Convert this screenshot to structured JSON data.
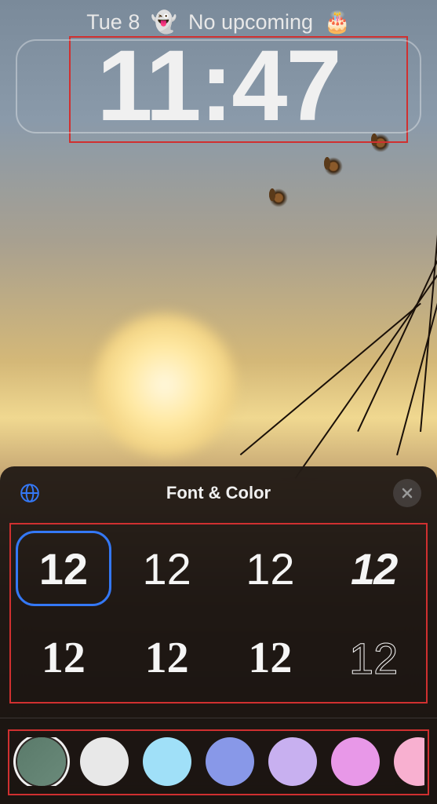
{
  "statusbar": {
    "date": "Tue 8",
    "ghost_icon": "👻",
    "upcoming_text": "No upcoming",
    "cake_icon": "🎂"
  },
  "clock": {
    "time": "11:47"
  },
  "sheet": {
    "title": "Font & Color",
    "globe_icon": "globe",
    "close_icon": "close"
  },
  "fonts": {
    "sample": "12",
    "options": [
      {
        "id": "sans-bold",
        "selected": true
      },
      {
        "id": "sans-light",
        "selected": false
      },
      {
        "id": "sans-regular",
        "selected": false
      },
      {
        "id": "stencil-bold",
        "selected": false
      },
      {
        "id": "serif-semibold",
        "selected": false
      },
      {
        "id": "serif-bold",
        "selected": false
      },
      {
        "id": "serif-black",
        "selected": false
      },
      {
        "id": "outline-thin",
        "selected": false
      }
    ]
  },
  "colors": {
    "options": [
      {
        "id": "dynamic",
        "hex": "#5a7a6a",
        "selected": true
      },
      {
        "id": "white",
        "hex": "#e8e8e8",
        "selected": false
      },
      {
        "id": "light-blue",
        "hex": "#a0e0f8",
        "selected": false
      },
      {
        "id": "periwinkle",
        "hex": "#8898e8",
        "selected": false
      },
      {
        "id": "lavender",
        "hex": "#c8b0f0",
        "selected": false
      },
      {
        "id": "magenta",
        "hex": "#e898e8",
        "selected": false
      },
      {
        "id": "pink",
        "hex": "#f8b0d0",
        "selected": false
      }
    ]
  }
}
